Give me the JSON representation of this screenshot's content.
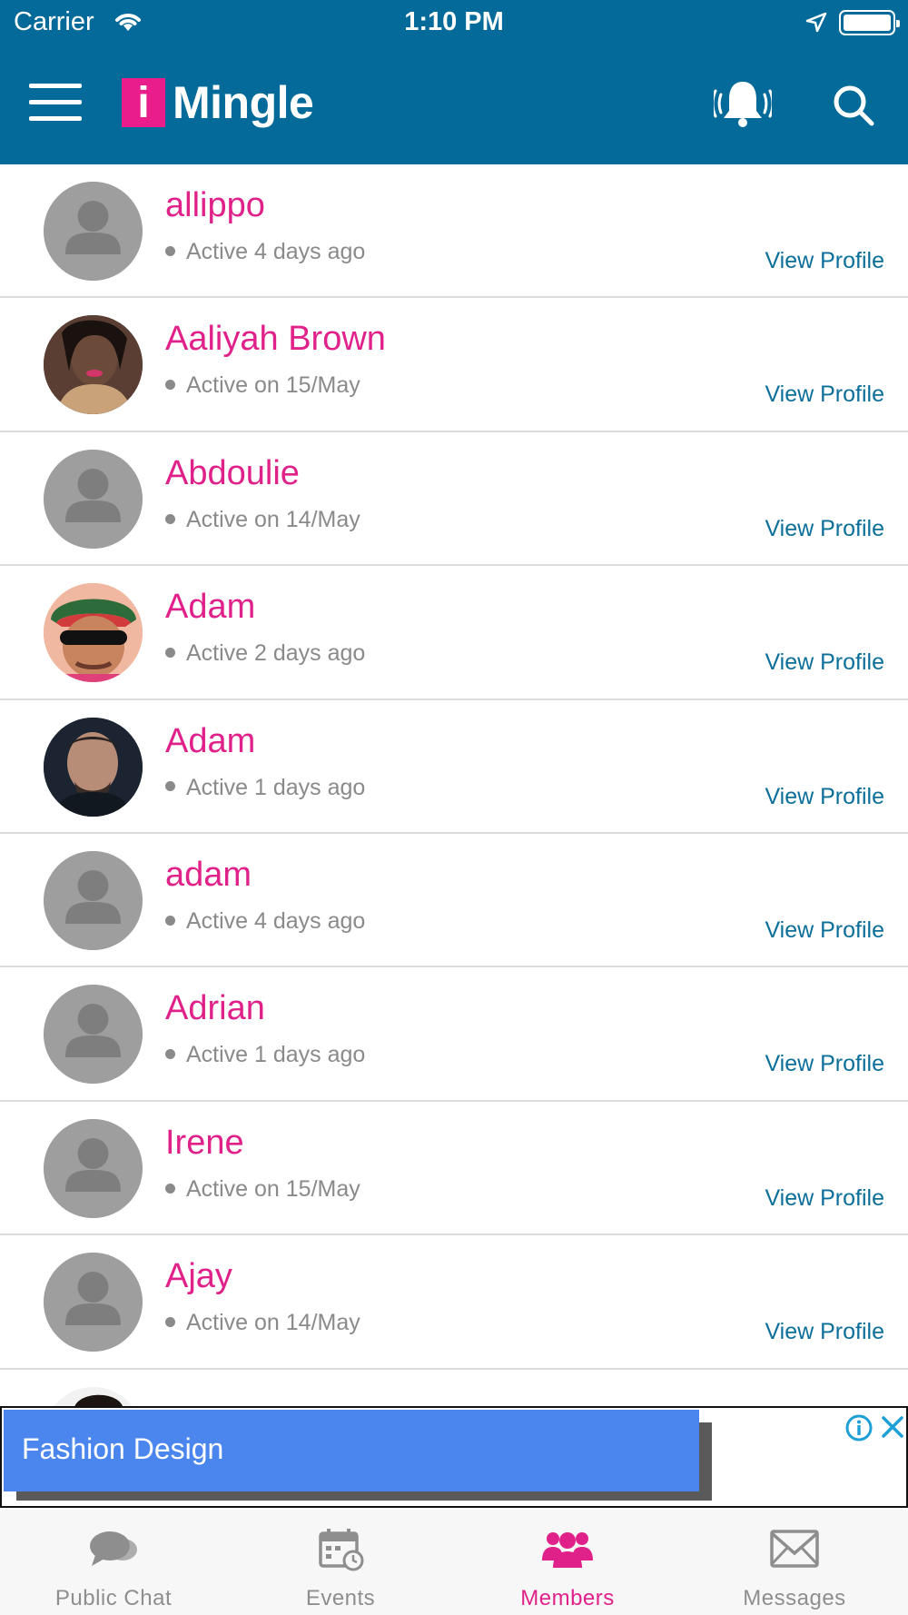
{
  "status_bar": {
    "carrier": "Carrier",
    "time": "1:10 PM"
  },
  "header": {
    "logo_letter": "i",
    "logo_text": "Mingle",
    "icons": [
      "menu-icon",
      "bell-icon",
      "search-icon"
    ]
  },
  "colors": {
    "header_bg": "#046a99",
    "accent_pink": "#e0218a",
    "link_blue": "#0c6f9a",
    "ad_blue": "#4a86ee"
  },
  "members": [
    {
      "name": "allippo",
      "status": "Active 4 days ago",
      "link": "View Profile",
      "avatar": "default"
    },
    {
      "name": "Aaliyah Brown",
      "status": "Active on 15/May",
      "link": "View Profile",
      "avatar": "photo"
    },
    {
      "name": "Abdoulie",
      "status": "Active on 14/May",
      "link": "View Profile",
      "avatar": "default"
    },
    {
      "name": "Adam",
      "status": "Active 2 days ago",
      "link": "View Profile",
      "avatar": "photo"
    },
    {
      "name": "Adam",
      "status": "Active 1 days ago",
      "link": "View Profile",
      "avatar": "photo"
    },
    {
      "name": "adam",
      "status": "Active 4 days ago",
      "link": "View Profile",
      "avatar": "default"
    },
    {
      "name": "Adrian",
      "status": "Active 1 days ago",
      "link": "View Profile",
      "avatar": "default"
    },
    {
      "name": "Irene",
      "status": "Active on 15/May",
      "link": "View Profile",
      "avatar": "default"
    },
    {
      "name": "Ajay",
      "status": "Active on 14/May",
      "link": "View Profile",
      "avatar": "default"
    }
  ],
  "ad": {
    "text": "Fashion Design"
  },
  "tabs": [
    {
      "label": "Public Chat",
      "icon": "chat-bubbles-icon",
      "active": false
    },
    {
      "label": "Events",
      "icon": "calendar-icon",
      "active": false
    },
    {
      "label": "Members",
      "icon": "members-icon",
      "active": true
    },
    {
      "label": "Messages",
      "icon": "envelope-icon",
      "active": false
    }
  ]
}
